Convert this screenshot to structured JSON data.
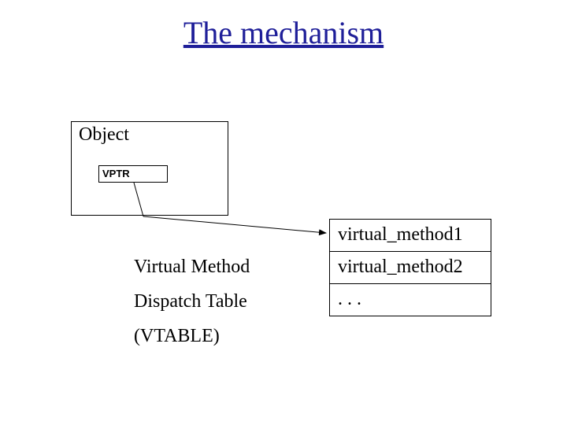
{
  "title": "The mechanism",
  "object_label": "Object",
  "vptr_label": "VPTR",
  "vtable_caption": {
    "line1": "Virtual Method",
    "line2": "Dispatch Table",
    "line3": "(VTABLE)"
  },
  "vtable_entries": {
    "e1": "virtual_method1",
    "e2": "virtual_method2",
    "e3": ". . ."
  }
}
